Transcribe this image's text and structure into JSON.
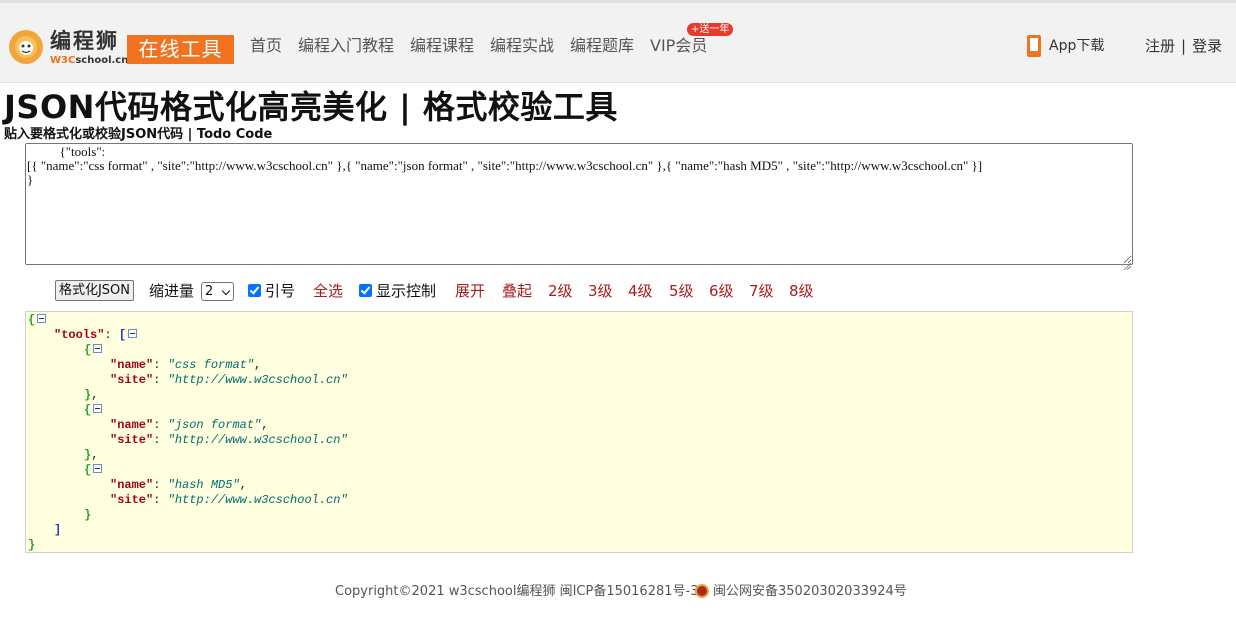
{
  "header": {
    "logo_title": "编程狮",
    "logo_sub_brand": "W3C",
    "logo_sub_rest": "school.cn",
    "tool_badge": "在线工具",
    "nav": [
      "首页",
      "编程入门教程",
      "编程课程",
      "编程实战",
      "编程题库",
      "VIP会员"
    ],
    "vip_badge": "+送一年",
    "app_download": "App下载",
    "register": "注册",
    "separator": "|",
    "login": "登录"
  },
  "page": {
    "title": "JSON代码格式化高亮美化 | 格式校验工具",
    "input_label": "贴入要格式化或校验JSON代码 | Todo Code",
    "input_value": "          {\"tools\":\n[{ \"name\":\"css format\" , \"site\":\"http://www.w3cschool.cn\" },{ \"name\":\"json format\" , \"site\":\"http://www.w3cschool.cn\" },{ \"name\":\"hash MD5\" , \"site\":\"http://www.w3cschool.cn\" }]\n}"
  },
  "toolbar": {
    "format_button": "格式化JSON",
    "indent_label": "缩进量",
    "indent_value": "2",
    "quotes_label": "引号",
    "quotes_checked": true,
    "select_all": "全选",
    "show_controls_label": "显示控制",
    "show_controls_checked": true,
    "expand": "展开",
    "collapse": "叠起",
    "levels": [
      "2级",
      "3级",
      "4级",
      "5级",
      "6级",
      "7级",
      "8级"
    ]
  },
  "output": {
    "root_key": "tools",
    "items": [
      {
        "name": "css format",
        "site": "http://www.w3cschool.cn"
      },
      {
        "name": "json format",
        "site": "http://www.w3cschool.cn"
      },
      {
        "name": "hash MD5",
        "site": "http://www.w3cschool.cn"
      }
    ],
    "field_name": "name",
    "field_site": "site"
  },
  "footer": {
    "copyright": "Copyright©2021 w3cschool编程狮 闽ICP备15016281号-3",
    "police": "闽公网安备35020302033924号"
  },
  "colors": {
    "brand_orange": "#f0731f",
    "link_red": "#a91d1d",
    "output_bg": "#ffffdf",
    "key_color": "#a3001f",
    "string_color": "#006e6e"
  }
}
